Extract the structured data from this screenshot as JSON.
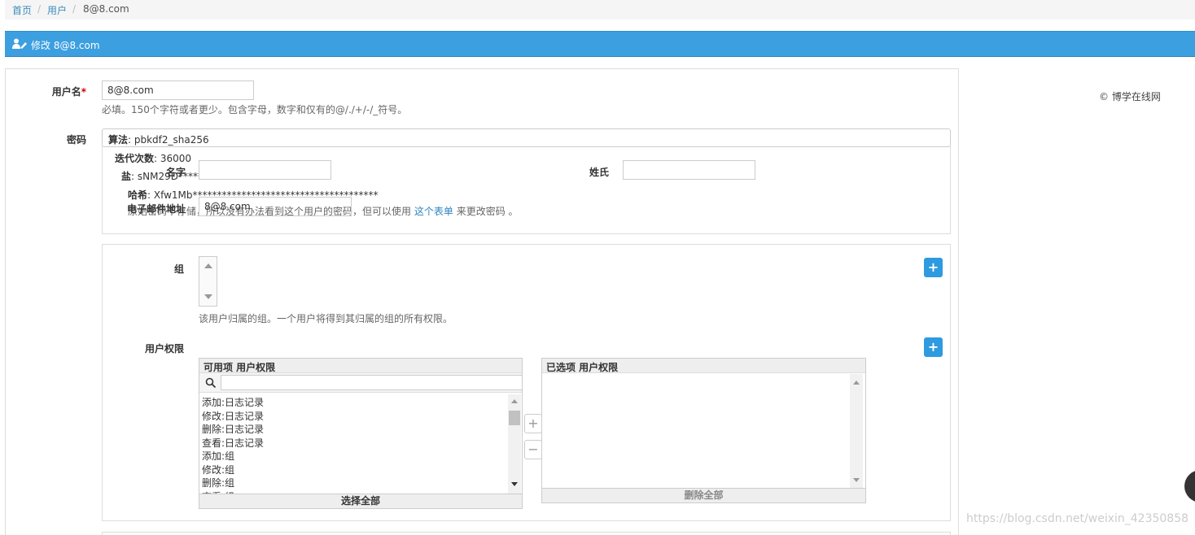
{
  "breadcrumb": {
    "home": "首页",
    "users": "用户",
    "current": "8@8.com",
    "sep": "/"
  },
  "header": {
    "title": "修改 8@8.com"
  },
  "username": {
    "label": "用户名",
    "required_mark": "*",
    "value": "8@8.com",
    "help": "必填。150个字符或者更少。包含字母，数字和仅有的@/./+/-/_符号。"
  },
  "password": {
    "label": "密码",
    "algorithm_label": "算法",
    "algorithm": ": pbkdf2_sha256",
    "iterations_label": "迭代次数",
    "iterations": ": 36000",
    "salt_label": "盐",
    "salt": ": sNM29D******",
    "hash_label": "哈希",
    "hash": ": Xfw1Mb**************************************",
    "note_before": "原始密码不存储，所以没有办法看到这个用户的密码，但可以使用",
    "note_link": "这个表单",
    "note_after": "来更改密码 。"
  },
  "first_name": {
    "label": "名字",
    "value": ""
  },
  "last_name": {
    "label": "姓氏",
    "value": ""
  },
  "email": {
    "label": "电子邮件地址",
    "value": "8@8.com"
  },
  "groups": {
    "label": "组",
    "help": "该用户归属的组。一个用户将得到其归属的组的所有权限。",
    "add": "+"
  },
  "permissions": {
    "label": "用户权限",
    "add": "+",
    "available_title": "可用项 用户权限",
    "chosen_title": "已选项 用户权限",
    "available": [
      "添加:日志记录",
      "修改:日志记录",
      "删除:日志记录",
      "查看:日志记录",
      "添加:组",
      "修改:组",
      "删除:组",
      "查看:组"
    ],
    "choose_all": "选择全部",
    "remove_all": "删除全部",
    "add_arrow": "+",
    "remove_arrow": "−"
  },
  "copyright": "© 博学在线网",
  "watermark": "https://blog.csdn.net/weixin_42350858",
  "colors": {
    "header": "#3c9fe0",
    "link": "#3c8dbc",
    "button": "#2e9ae0"
  }
}
